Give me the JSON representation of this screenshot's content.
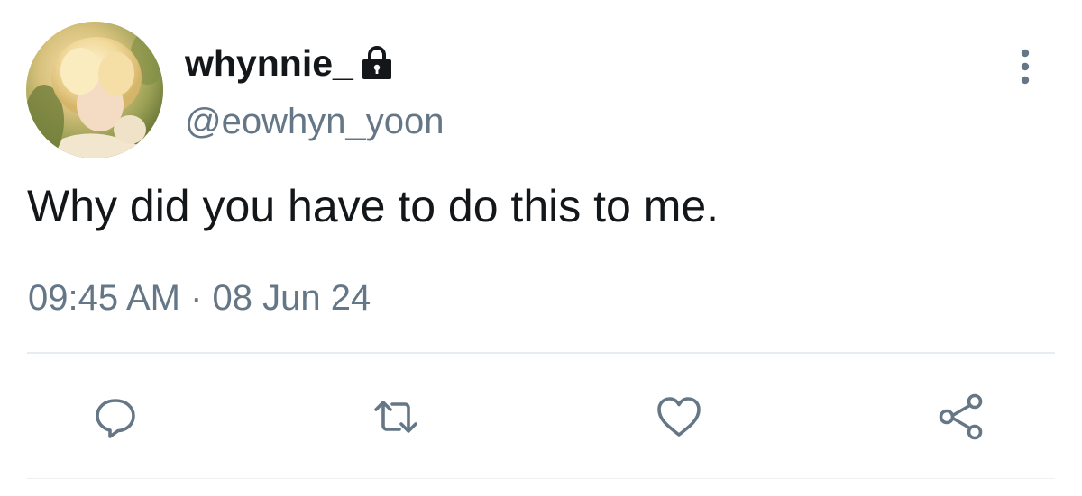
{
  "user": {
    "display_name": "whynnie_",
    "handle": "@eowhyn_yoon",
    "avatar_icon": "profile-photo-avatar",
    "protected_icon": "lock-icon"
  },
  "tweet": {
    "text": "Why did you have to do this to me.",
    "timestamp": "09:45 AM · 08 Jun 24"
  },
  "actions": [
    {
      "name": "reply",
      "icon": "comment-bubble-icon"
    },
    {
      "name": "retweet",
      "icon": "retweet-arrows-icon"
    },
    {
      "name": "like",
      "icon": "heart-icon"
    },
    {
      "name": "share",
      "icon": "share-nodes-icon"
    }
  ],
  "menu": {
    "icon": "vertical-ellipsis-icon"
  },
  "colors": {
    "text": "#14171a",
    "secondary": "#657786",
    "divider": "#e6ecf0",
    "background": "#ffffff"
  }
}
